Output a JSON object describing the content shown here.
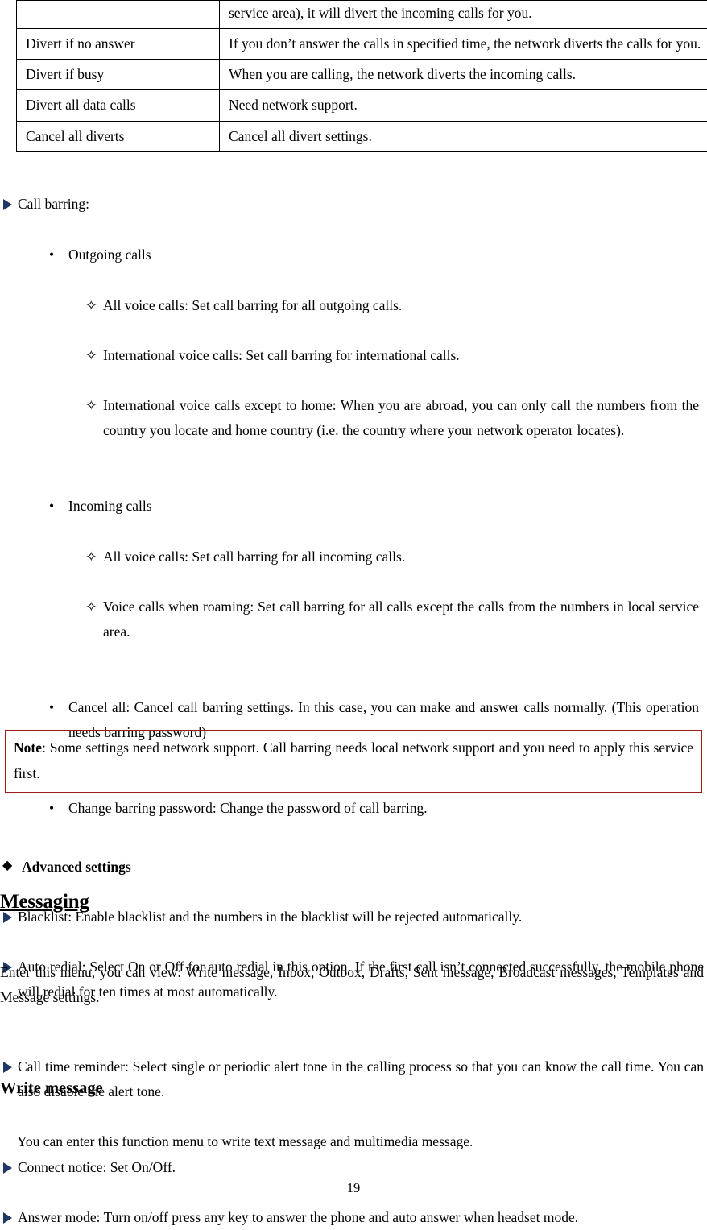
{
  "document": {
    "page_number": "19",
    "markers": {
      "triangle": "▶",
      "dot": "•",
      "hollow_diamond": "✧",
      "filled_diamond": "◆"
    },
    "colors": {
      "triangle_bullet": "#1F3864",
      "note_border": "#9E1A1A",
      "text": "#000000",
      "table_border": "#000000"
    }
  },
  "divert_table": {
    "rows": [
      {
        "label": "",
        "description": "service area), it will divert the incoming calls for you."
      },
      {
        "label": "Divert if no answer",
        "description": "If you don’t answer the calls in specified time, the network diverts the calls for you."
      },
      {
        "label": "Divert if busy",
        "description": "When you are calling, the network diverts the incoming calls."
      },
      {
        "label": "Divert all data calls",
        "description": "Need network support."
      },
      {
        "label": "Cancel all diverts",
        "description": "Cancel all divert settings."
      }
    ]
  },
  "call_barring": {
    "heading": "Call barring:",
    "groups": [
      {
        "title": "Outgoing calls",
        "items": [
          "All voice calls: Set call barring for all outgoing calls.",
          "International voice calls: Set call barring for international calls.",
          "International voice calls except to home: When you are abroad, you can only call the numbers from the country you locate and home country (i.e. the country where your network operator locates)."
        ]
      },
      {
        "title": "Incoming calls",
        "items": [
          "All voice calls: Set call barring for all incoming calls.",
          "Voice calls when roaming: Set call barring for all calls except the calls from the numbers in local service area."
        ]
      }
    ],
    "extra_items": [
      "Cancel all: Cancel call barring settings. In this case, you can make and answer calls normally. (This operation needs barring password)",
      "Change barring password: Change the password of call barring."
    ]
  },
  "advanced_settings": {
    "heading": "Advanced settings",
    "items": [
      "Blacklist: Enable blacklist and the numbers in the blacklist will be rejected automatically.",
      "Auto redial: Select On or Off for auto redial in this option. If the first call isn’t connected successfully, the mobile phone will redial for ten times at most automatically.",
      "Call time reminder: Select single or periodic alert tone in the calling process so that you can know the call time. You can also disable the alert tone.",
      "Connect notice: Set On/Off.",
      "Answer mode: Turn on/off press any key to answer the phone and auto answer when headset mode."
    ]
  },
  "note": {
    "label": "Note",
    "text": ": Some settings need network support. Call barring needs local network support and you need to apply this service first."
  },
  "messaging": {
    "heading": "Messaging",
    "intro": "Enter this menu, you can view: Write message, Inbox, Outbox, Drafts, Sent message, Broadcast messages, Templates and Message settings.",
    "write_message": {
      "heading": "Write message",
      "text": "You can enter this function menu to write text message and multimedia message."
    }
  }
}
